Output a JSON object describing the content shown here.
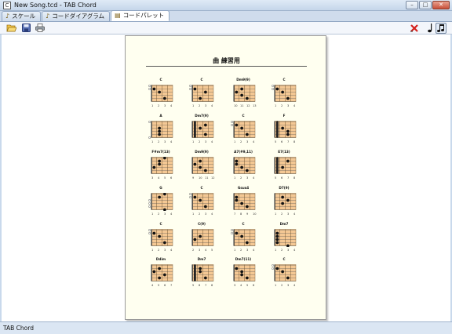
{
  "window": {
    "title": "New Song.tcd - TAB Chord",
    "buttons": [
      "–",
      "□",
      "✕"
    ]
  },
  "tabs": [
    {
      "label": "スケール",
      "icon": "♪"
    },
    {
      "label": "コードダイアグラム",
      "icon": "♪"
    },
    {
      "label": "コードパレット",
      "icon": "▤"
    }
  ],
  "toolbar": {
    "left": [
      "open-folder",
      "save",
      "print"
    ],
    "right": [
      "delete-red-x",
      "single-note",
      "double-note"
    ]
  },
  "document": {
    "title": "曲 練習用"
  },
  "chords": [
    {
      "name": "C",
      "frets": [
        "1",
        "2",
        "3",
        "4"
      ],
      "open": [
        1,
        1,
        0,
        0,
        0,
        0
      ],
      "barre": false,
      "dots": [
        [
          1,
          1
        ],
        [
          2,
          2
        ],
        [
          4,
          3
        ]
      ]
    },
    {
      "name": "C",
      "frets": [
        "1",
        "2",
        "3",
        "4"
      ],
      "open": [
        1,
        1,
        0,
        0,
        0,
        0
      ],
      "barre": false,
      "dots": [
        [
          1,
          1
        ],
        [
          2,
          3
        ],
        [
          4,
          2
        ]
      ]
    },
    {
      "name": "Dm9(9)",
      "frets": [
        "10",
        "11",
        "12",
        "13"
      ],
      "open": [
        0,
        0,
        0,
        0,
        0,
        0
      ],
      "barre": false,
      "dots": [
        [
          1,
          2
        ],
        [
          2,
          1
        ],
        [
          3,
          2
        ],
        [
          4,
          3
        ]
      ]
    },
    {
      "name": "C",
      "frets": [
        "1",
        "2",
        "3",
        "4"
      ],
      "open": [
        1,
        1,
        0,
        0,
        0,
        0
      ],
      "barre": false,
      "dots": [
        [
          1,
          1
        ],
        [
          2,
          2
        ],
        [
          4,
          3
        ]
      ]
    },
    {
      "name": "A",
      "frets": [
        "1",
        "2",
        "3",
        "4"
      ],
      "open": [
        1,
        0,
        0,
        0,
        0,
        1
      ],
      "barre": false,
      "dots": [
        [
          2,
          2
        ],
        [
          3,
          2
        ],
        [
          4,
          2
        ]
      ]
    },
    {
      "name": "Dm7(9)",
      "frets": [
        "1",
        "2",
        "3",
        "4"
      ],
      "open": [
        0,
        0,
        0,
        0,
        0,
        0
      ],
      "barre": true,
      "dots": [
        [
          1,
          3
        ],
        [
          2,
          2
        ],
        [
          4,
          3
        ]
      ]
    },
    {
      "name": "C",
      "frets": [
        "1",
        "2",
        "3",
        "4"
      ],
      "open": [
        1,
        1,
        0,
        0,
        0,
        0
      ],
      "barre": false,
      "dots": [
        [
          1,
          1
        ],
        [
          2,
          2
        ],
        [
          4,
          3
        ]
      ]
    },
    {
      "name": "F",
      "frets": [
        "5",
        "6",
        "7",
        "8"
      ],
      "open": [
        0,
        0,
        0,
        0,
        0,
        0
      ],
      "barre": true,
      "dots": [
        [
          2,
          2
        ],
        [
          3,
          3
        ],
        [
          4,
          3
        ]
      ]
    },
    {
      "name": "F#m7(13)",
      "frets": [
        "3",
        "4",
        "5",
        "6"
      ],
      "open": [
        0,
        0,
        0,
        0,
        0,
        0
      ],
      "barre": false,
      "dots": [
        [
          0,
          3
        ],
        [
          1,
          2
        ],
        [
          2,
          2
        ],
        [
          3,
          1
        ]
      ]
    },
    {
      "name": "Dm9(9)",
      "frets": [
        "9",
        "10",
        "11",
        "12"
      ],
      "open": [
        0,
        0,
        0,
        0,
        0,
        0
      ],
      "barre": false,
      "dots": [
        [
          1,
          2
        ],
        [
          2,
          1
        ],
        [
          3,
          2
        ],
        [
          4,
          3
        ]
      ]
    },
    {
      "name": "A7(#9,11)",
      "frets": [
        "1",
        "2",
        "3",
        "4"
      ],
      "open": [
        0,
        0,
        0,
        0,
        0,
        0
      ],
      "barre": false,
      "dots": [
        [
          1,
          1
        ],
        [
          2,
          1
        ],
        [
          3,
          2
        ],
        [
          4,
          3
        ]
      ]
    },
    {
      "name": "E7(13)",
      "frets": [
        "5",
        "6",
        "7",
        "8"
      ],
      "open": [
        0,
        0,
        0,
        0,
        0,
        0
      ],
      "barre": true,
      "dots": [
        [
          1,
          3
        ],
        [
          3,
          2
        ]
      ]
    },
    {
      "name": "G",
      "frets": [
        "1",
        "2",
        "3",
        "4"
      ],
      "open": [
        0,
        0,
        1,
        1,
        1,
        0
      ],
      "barre": false,
      "dots": [
        [
          0,
          3
        ],
        [
          1,
          2
        ],
        [
          5,
          3
        ]
      ]
    },
    {
      "name": "C",
      "frets": [
        "1",
        "2",
        "3",
        "4"
      ],
      "open": [
        1,
        1,
        0,
        0,
        0,
        0
      ],
      "barre": false,
      "dots": [
        [
          1,
          1
        ],
        [
          2,
          2
        ],
        [
          4,
          3
        ]
      ]
    },
    {
      "name": "Gsus4",
      "frets": [
        "7",
        "8",
        "9",
        "10"
      ],
      "open": [
        0,
        0,
        0,
        0,
        0,
        0
      ],
      "barre": false,
      "dots": [
        [
          1,
          1
        ],
        [
          2,
          1
        ],
        [
          3,
          2
        ],
        [
          4,
          3
        ]
      ]
    },
    {
      "name": "D7(9)",
      "frets": [
        "1",
        "2",
        "3",
        "4"
      ],
      "open": [
        0,
        0,
        0,
        0,
        0,
        0
      ],
      "barre": false,
      "dots": [
        [
          1,
          2
        ],
        [
          2,
          3
        ],
        [
          3,
          2
        ]
      ]
    },
    {
      "name": "C",
      "frets": [
        "1",
        "2",
        "3",
        "4"
      ],
      "open": [
        1,
        1,
        0,
        0,
        0,
        0
      ],
      "barre": false,
      "dots": [
        [
          1,
          1
        ],
        [
          2,
          2
        ],
        [
          4,
          3
        ]
      ]
    },
    {
      "name": "C(9)",
      "frets": [
        "2",
        "3",
        "4",
        "5"
      ],
      "open": [
        0,
        0,
        0,
        0,
        0,
        0
      ],
      "barre": false,
      "dots": [
        [
          2,
          2
        ],
        [
          3,
          1
        ]
      ]
    },
    {
      "name": "C",
      "frets": [
        "1",
        "2",
        "3",
        "4"
      ],
      "open": [
        1,
        1,
        0,
        0,
        0,
        0
      ],
      "barre": false,
      "dots": [
        [
          1,
          1
        ],
        [
          2,
          2
        ],
        [
          4,
          3
        ]
      ]
    },
    {
      "name": "Dm7",
      "frets": [
        "1",
        "2",
        "3",
        "4"
      ],
      "open": [
        0,
        0,
        0,
        0,
        0,
        0
      ],
      "barre": false,
      "dots": [
        [
          1,
          1
        ],
        [
          2,
          1
        ],
        [
          3,
          1
        ],
        [
          4,
          1
        ],
        [
          5,
          3
        ]
      ]
    },
    {
      "name": "Ddim",
      "frets": [
        "4",
        "5",
        "6",
        "7"
      ],
      "open": [
        0,
        0,
        0,
        0,
        0,
        0
      ],
      "barre": false,
      "dots": [
        [
          1,
          2
        ],
        [
          2,
          1
        ],
        [
          3,
          3
        ],
        [
          4,
          2
        ]
      ]
    },
    {
      "name": "Dm7",
      "frets": [
        "5",
        "6",
        "7",
        "8"
      ],
      "open": [
        0,
        0,
        0,
        0,
        0,
        0
      ],
      "barre": true,
      "dots": [
        [
          1,
          2
        ],
        [
          2,
          2
        ],
        [
          4,
          3
        ]
      ]
    },
    {
      "name": "Dm7(11)",
      "frets": [
        "3",
        "4",
        "5",
        "6"
      ],
      "open": [
        0,
        0,
        0,
        0,
        0,
        0
      ],
      "barre": false,
      "dots": [
        [
          1,
          1
        ],
        [
          2,
          2
        ],
        [
          3,
          2
        ],
        [
          4,
          3
        ]
      ]
    },
    {
      "name": "C",
      "frets": [
        "1",
        "2",
        "3",
        "4"
      ],
      "open": [
        1,
        1,
        0,
        0,
        0,
        0
      ],
      "barre": false,
      "dots": [
        [
          1,
          1
        ],
        [
          2,
          2
        ],
        [
          4,
          3
        ]
      ]
    }
  ],
  "status": {
    "text": "TAB Chord"
  }
}
